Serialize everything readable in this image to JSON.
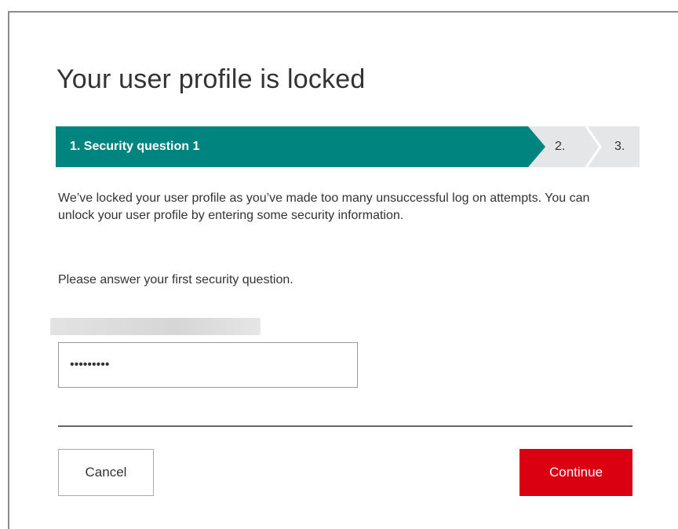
{
  "page": {
    "title": "Your user profile is locked"
  },
  "stepper": {
    "steps": [
      {
        "label": "1. Security question 1",
        "state": "active"
      },
      {
        "label": "2.",
        "state": "upcoming"
      },
      {
        "label": "3.",
        "state": "upcoming"
      }
    ],
    "colors": {
      "active": "#00847f",
      "upcoming": "#e5e6e8"
    }
  },
  "content": {
    "intro": "We’ve locked your user profile as you’ve made too many unsuccessful log on attempts. You can unlock your user profile by entering some security information.",
    "prompt": "Please answer your first security question."
  },
  "form": {
    "answer_value": "•••••••••"
  },
  "actions": {
    "cancel_label": "Cancel",
    "continue_label": "Continue",
    "continue_color": "#db0011"
  }
}
